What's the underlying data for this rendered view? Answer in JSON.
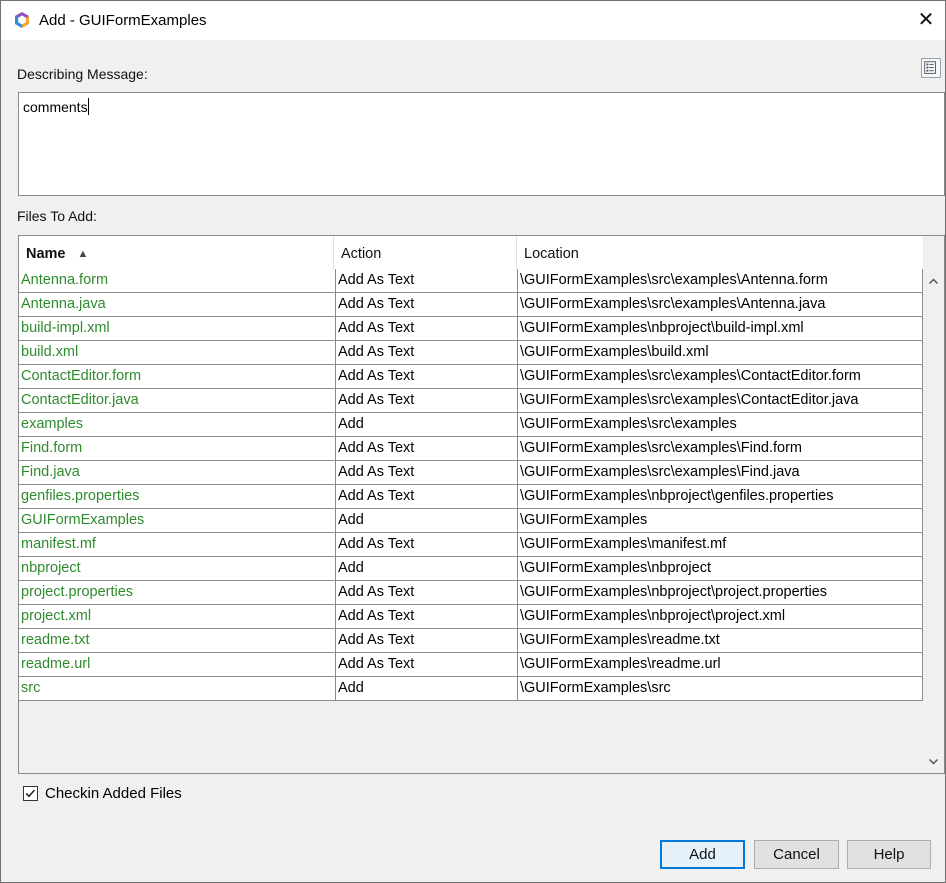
{
  "window": {
    "title": "Add - GUIFormExamples",
    "close_glyph": "✕"
  },
  "message": {
    "label": "Describing Message:",
    "value": "comments"
  },
  "files": {
    "label": "Files To Add:",
    "columns": {
      "name": "Name",
      "action": "Action",
      "location": "Location"
    },
    "sort_indicator": "▲",
    "rows": [
      {
        "name": "Antenna.form",
        "action": "Add As Text",
        "location": "\\GUIFormExamples\\src\\examples\\Antenna.form"
      },
      {
        "name": "Antenna.java",
        "action": "Add As Text",
        "location": "\\GUIFormExamples\\src\\examples\\Antenna.java"
      },
      {
        "name": "build-impl.xml",
        "action": "Add As Text",
        "location": "\\GUIFormExamples\\nbproject\\build-impl.xml"
      },
      {
        "name": "build.xml",
        "action": "Add As Text",
        "location": "\\GUIFormExamples\\build.xml"
      },
      {
        "name": "ContactEditor.form",
        "action": "Add As Text",
        "location": "\\GUIFormExamples\\src\\examples\\ContactEditor.form"
      },
      {
        "name": "ContactEditor.java",
        "action": "Add As Text",
        "location": "\\GUIFormExamples\\src\\examples\\ContactEditor.java"
      },
      {
        "name": "examples",
        "action": "Add",
        "location": "\\GUIFormExamples\\src\\examples"
      },
      {
        "name": "Find.form",
        "action": "Add As Text",
        "location": "\\GUIFormExamples\\src\\examples\\Find.form"
      },
      {
        "name": "Find.java",
        "action": "Add As Text",
        "location": "\\GUIFormExamples\\src\\examples\\Find.java"
      },
      {
        "name": "genfiles.properties",
        "action": "Add As Text",
        "location": "\\GUIFormExamples\\nbproject\\genfiles.properties"
      },
      {
        "name": "GUIFormExamples",
        "action": "Add",
        "location": "\\GUIFormExamples"
      },
      {
        "name": "manifest.mf",
        "action": "Add As Text",
        "location": "\\GUIFormExamples\\manifest.mf"
      },
      {
        "name": "nbproject",
        "action": "Add",
        "location": "\\GUIFormExamples\\nbproject"
      },
      {
        "name": "project.properties",
        "action": "Add As Text",
        "location": "\\GUIFormExamples\\nbproject\\project.properties"
      },
      {
        "name": "project.xml",
        "action": "Add As Text",
        "location": "\\GUIFormExamples\\nbproject\\project.xml"
      },
      {
        "name": "readme.txt",
        "action": "Add As Text",
        "location": "\\GUIFormExamples\\readme.txt"
      },
      {
        "name": "readme.url",
        "action": "Add As Text",
        "location": "\\GUIFormExamples\\readme.url"
      },
      {
        "name": "src",
        "action": "Add",
        "location": "\\GUIFormExamples\\src"
      }
    ]
  },
  "checkin": {
    "label": "Checkin Added Files",
    "checked": true
  },
  "buttons": {
    "add": "Add",
    "cancel": "Cancel",
    "help": "Help"
  },
  "colors": {
    "file_name": "#2e8b2e",
    "default_button_border": "#0078d7"
  }
}
